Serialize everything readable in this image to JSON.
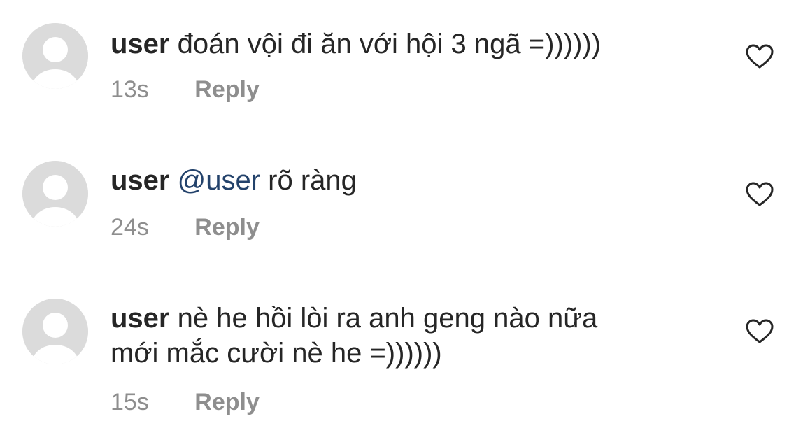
{
  "comments": [
    {
      "username": "user",
      "mention": "",
      "text": "đoán vội đi ăn với hội 3 ngã =))))))",
      "line2": "",
      "time": "13s",
      "reply_label": "Reply",
      "avatar_icon": "default-avatar-icon",
      "like_icon": "heart-outline-icon"
    },
    {
      "username": "user",
      "mention": "@user",
      "text": "rõ ràng",
      "line2": "",
      "time": "24s",
      "reply_label": "Reply",
      "avatar_icon": "default-avatar-icon",
      "like_icon": "heart-outline-icon"
    },
    {
      "username": "user",
      "mention": "",
      "text": "nè he hồi lòi ra anh geng nào nữa",
      "line2": "mới mắc cười nè he =))))))",
      "time": "15s",
      "reply_label": "Reply",
      "avatar_icon": "default-avatar-icon",
      "like_icon": "heart-outline-icon"
    }
  ],
  "colors": {
    "text": "#262626",
    "secondary": "#8e8e8e",
    "mention": "#23426b",
    "avatar_bg": "#dbdbdb"
  }
}
